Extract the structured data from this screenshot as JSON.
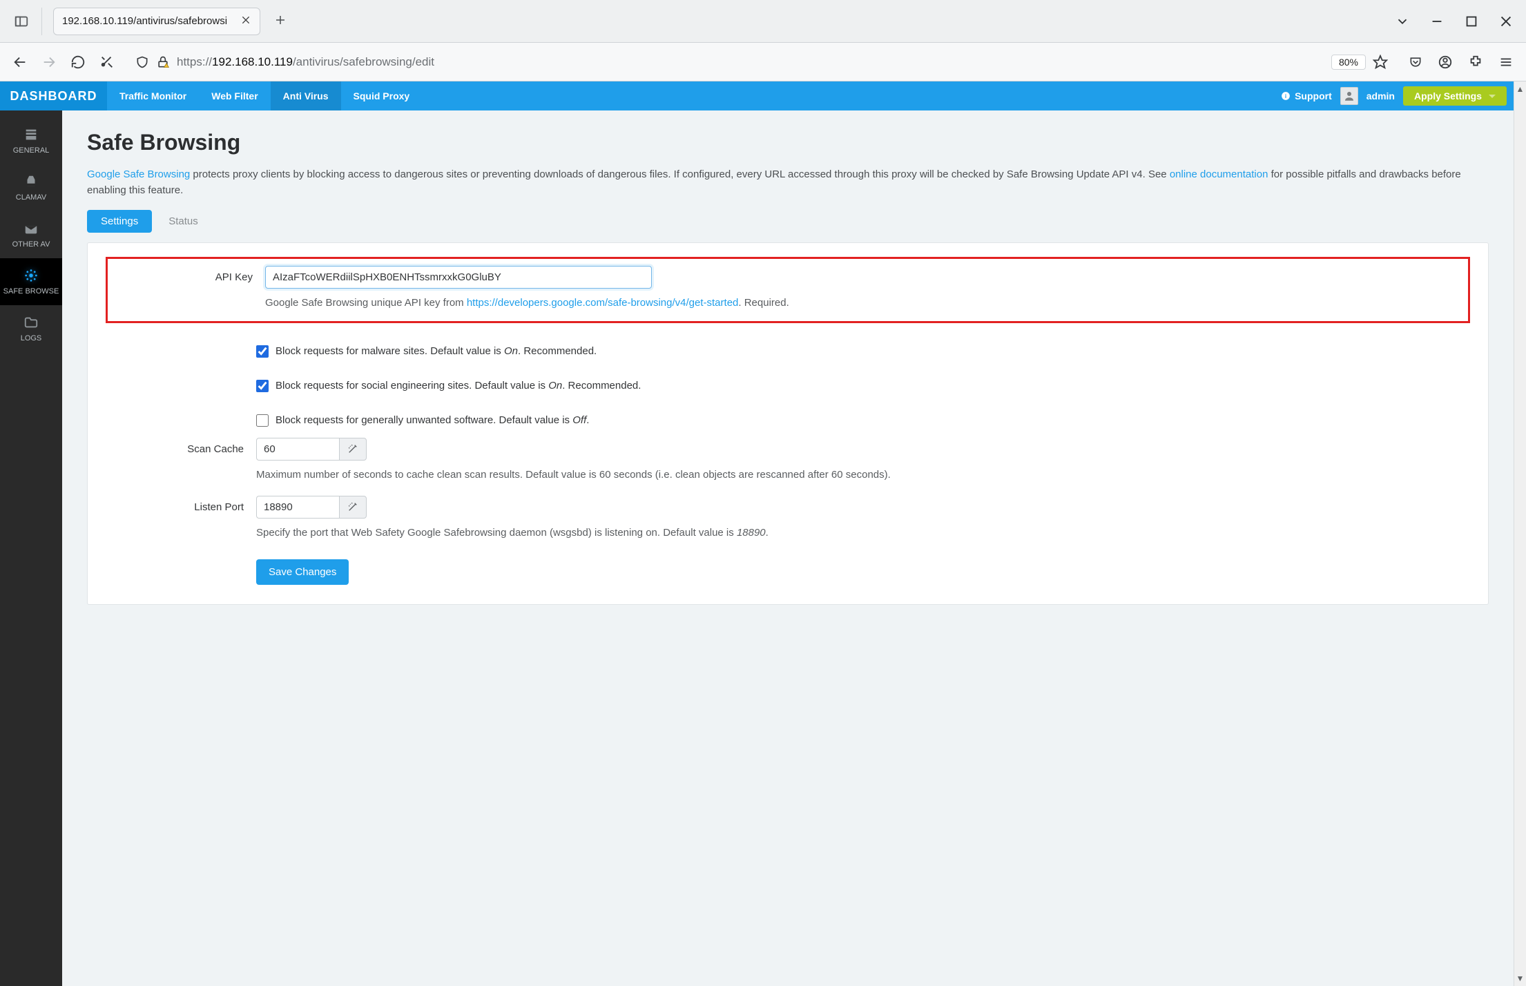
{
  "browser": {
    "tab_title": "192.168.10.119/antivirus/safebrowsi",
    "url_scheme": "https://",
    "url_host": "192.168.10.119",
    "url_path": "/antivirus/safebrowsing/edit",
    "zoom": "80%"
  },
  "topbar": {
    "brand": "DASHBOARD",
    "nav": {
      "traffic": "Traffic Monitor",
      "webfilter": "Web Filter",
      "antivirus": "Anti Virus",
      "squid": "Squid Proxy"
    },
    "support": "Support",
    "username": "admin",
    "apply": "Apply Settings"
  },
  "sidebar": {
    "general": "GENERAL",
    "clamav": "CLAMAV",
    "otherav": "OTHER AV",
    "safebrowse": "SAFE BROWSE",
    "logs": "LOGS"
  },
  "page": {
    "title": "Safe Browsing",
    "intro_link1": "Google Safe Browsing",
    "intro_text1": " protects proxy clients by blocking access to dangerous sites or preventing downloads of dangerous files. If configured, every URL accessed through this proxy will be checked by Safe Browsing Update API v4. See ",
    "intro_link2": "online documentation",
    "intro_text2": " for possible pitfalls and drawbacks before enabling this feature.",
    "tabs": {
      "settings": "Settings",
      "status": "Status"
    }
  },
  "form": {
    "api_key_label": "API Key",
    "api_key_value": "AIzaFTcoWERdiilSpHXB0ENHTssmrxxkG0GluBY",
    "api_key_help_pre": "Google Safe Browsing unique API key from ",
    "api_key_help_link": "https://developers.google.com/safe-browsing/v4/get-started",
    "api_key_help_post": ". Required.",
    "chk_malware_pre": "Block requests for malware sites. Default value is ",
    "chk_malware_def": "On",
    "chk_malware_post": ". Recommended.",
    "chk_social_pre": "Block requests for social engineering sites. Default value is ",
    "chk_social_def": "On",
    "chk_social_post": ". Recommended.",
    "chk_unwanted_pre": "Block requests for generally unwanted software. Default value is ",
    "chk_unwanted_def": "Off",
    "chk_unwanted_post": ".",
    "scan_cache_label": "Scan Cache",
    "scan_cache_value": "60",
    "scan_cache_help": "Maximum number of seconds to cache clean scan results. Default value is 60 seconds (i.e. clean objects are rescanned after 60 seconds).",
    "listen_port_label": "Listen Port",
    "listen_port_value": "18890",
    "listen_port_help_pre": "Specify the port that Web Safety Google Safebrowsing daemon (wsgsbd) is listening on. Default value is ",
    "listen_port_help_def": "18890",
    "listen_port_help_post": ".",
    "save": "Save Changes"
  }
}
